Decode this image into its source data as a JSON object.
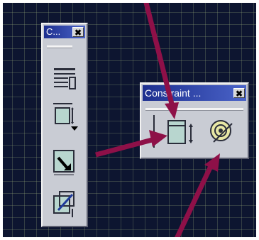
{
  "left_toolbar": {
    "title": "C...",
    "close_label": "✖",
    "tools": [
      {
        "icon": "lines-table-icon"
      },
      {
        "icon": "constraint-dropdown-icon"
      },
      {
        "icon": "box-arrow-icon"
      },
      {
        "icon": "fix-together-icon"
      }
    ]
  },
  "constraint_toolbar": {
    "title": "Constraint ...",
    "close_label": "✖",
    "tools": [
      {
        "icon": "constraint-box-icon"
      },
      {
        "icon": "anchor-target-icon"
      }
    ]
  },
  "colors": {
    "background": "#0d1530",
    "grid": "#9aaa78",
    "toolbar": "#c9ccd4",
    "title_bar": "#1d2f8f",
    "arrow": "#8e1048"
  }
}
